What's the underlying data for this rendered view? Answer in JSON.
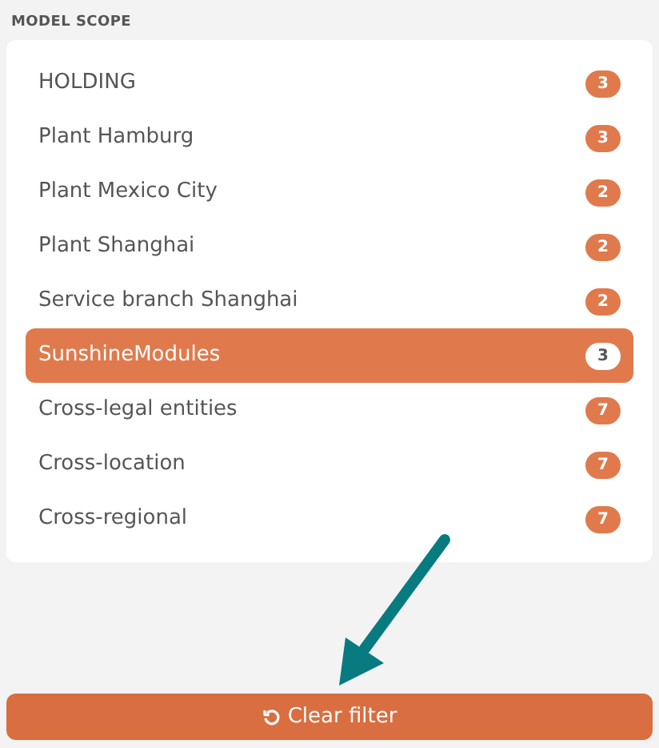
{
  "section_title": "MODEL SCOPE",
  "scope_items": [
    {
      "label": "HOLDING",
      "count": "3",
      "selected": false
    },
    {
      "label": "Plant Hamburg",
      "count": "3",
      "selected": false
    },
    {
      "label": "Plant Mexico City",
      "count": "2",
      "selected": false
    },
    {
      "label": "Plant Shanghai",
      "count": "2",
      "selected": false
    },
    {
      "label": "Service branch Shanghai",
      "count": "2",
      "selected": false
    },
    {
      "label": "SunshineModules",
      "count": "3",
      "selected": true
    },
    {
      "label": "Cross-legal entities",
      "count": "7",
      "selected": false
    },
    {
      "label": "Cross-location",
      "count": "7",
      "selected": false
    },
    {
      "label": "Cross-regional",
      "count": "7",
      "selected": false
    }
  ],
  "clear_button": {
    "label": "Clear filter"
  }
}
